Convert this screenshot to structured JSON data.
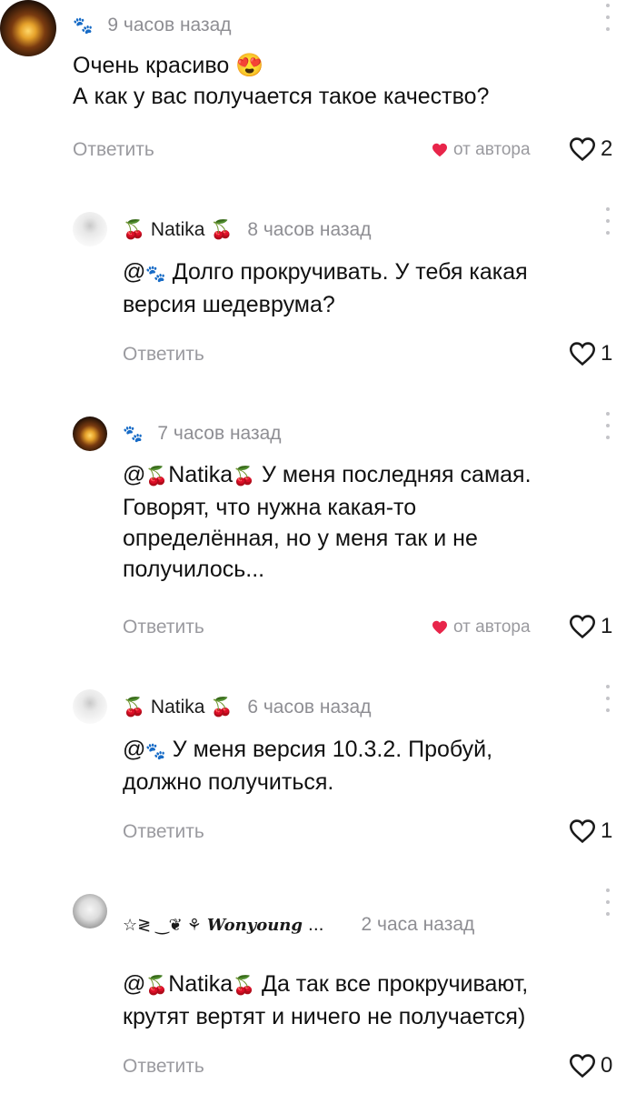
{
  "icons": {
    "paw": "🐾",
    "cherry": "🍒",
    "heart_eyes": "😍"
  },
  "common": {
    "reply_label": "Ответить",
    "from_author_label": "от автора"
  },
  "comments": [
    {
      "author": "",
      "time": "9 часов назад",
      "text_line1": "Очень красиво",
      "text_line2": "А как у вас получается такое качество?",
      "likes": "2",
      "liked_by_author": true
    },
    {
      "author": "Natika",
      "time": "8 часов назад",
      "mention": "@",
      "text": "Долго прокручивать. У тебя какая версия шедеврума?",
      "likes": "1",
      "liked_by_author": false
    },
    {
      "author": "",
      "time": "7 часов назад",
      "mention": "@",
      "mention_name": "Natika",
      "text": "У меня последняя самая. Говорят, что нужна какая-то определённая, но у меня так и не получилось...",
      "likes": "1",
      "liked_by_author": true
    },
    {
      "author": "Natika",
      "time": "6 часов назад",
      "mention": "@",
      "text": "У меня версия 10.3.2. Пробуй, должно получиться.",
      "likes": "1",
      "liked_by_author": false
    },
    {
      "author_prefix": "☆≷ ‿❦ ⚘",
      "author": "Wonyoung",
      "author_suffix": "...",
      "time": "2 часа назад",
      "mention": "@",
      "mention_name": "Natika",
      "text": "Да так все прокручивают, крутят вертят и ничего не получается)",
      "likes": "0",
      "liked_by_author": false
    }
  ],
  "colors": {
    "heart_author": "#e8254a",
    "muted": "#9a9a9f"
  }
}
